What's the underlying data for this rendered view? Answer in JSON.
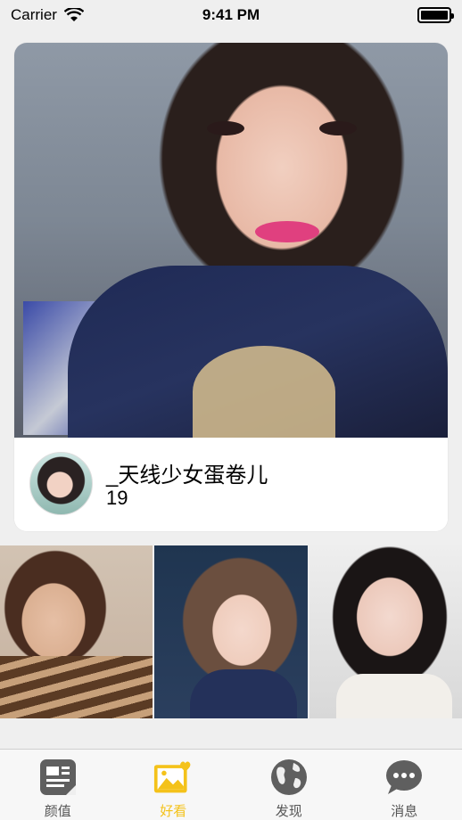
{
  "status_bar": {
    "carrier": "Carrier",
    "time": "9:41 PM"
  },
  "featured": {
    "name": "_天线少女蛋卷儿",
    "age": "19"
  },
  "tabs": [
    {
      "label": "颜值",
      "icon": "document-icon",
      "active": false
    },
    {
      "label": "好看",
      "icon": "photo-heart-icon",
      "active": true
    },
    {
      "label": "发现",
      "icon": "globe-icon",
      "active": false
    },
    {
      "label": "消息",
      "icon": "chat-bubble-icon",
      "active": false
    }
  ],
  "colors": {
    "accent": "#f4c21a",
    "tab_icon_gray": "#5f5f5f",
    "background": "#efefef"
  }
}
